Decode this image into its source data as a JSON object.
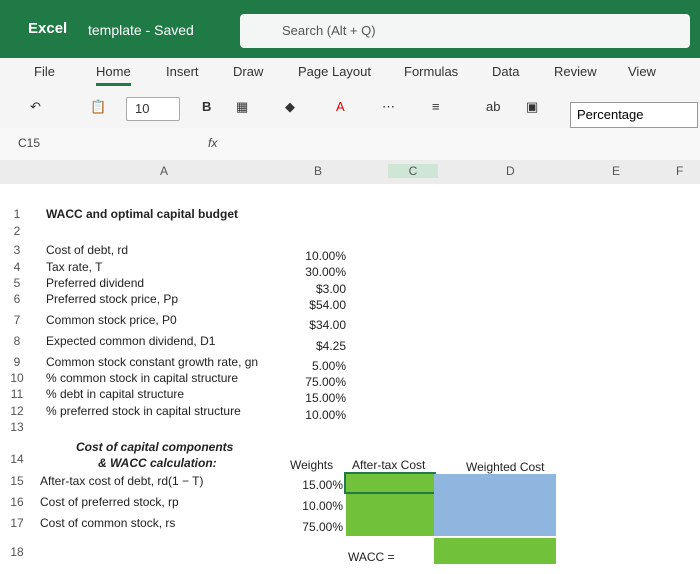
{
  "titlebar": {
    "app_name": "Excel",
    "doc_title": "template - Saved",
    "search_placeholder": "Search (Alt + Q)"
  },
  "ribbon": {
    "tabs": [
      "File",
      "Home",
      "Insert",
      "Draw",
      "Page Layout",
      "Formulas",
      "Data",
      "Review",
      "View"
    ]
  },
  "toolbar": {
    "font_size": "10",
    "bold": "B",
    "number_format": "Percentage"
  },
  "formula_bar": {
    "name_box": "C15",
    "fx": "fx"
  },
  "columns": [
    "A",
    "B",
    "C",
    "D",
    "E",
    "F"
  ],
  "rows": [
    "1",
    "2",
    "3",
    "4",
    "5",
    "6",
    "7",
    "8",
    "9",
    "10",
    "11",
    "12",
    "13",
    "14",
    "15",
    "16",
    "17",
    "18"
  ],
  "sheet": {
    "title": "WACC and optimal capital budget",
    "labels": [
      "Cost of debt, rd",
      "Tax rate, T",
      "Preferred dividend",
      "Preferred stock price, Pp",
      "Common stock price, P0",
      "Expected common dividend, D1",
      "Common stock constant growth rate, gn",
      "% common stock in capital structure",
      "% debt in capital structure",
      "% preferred stock in capital structure"
    ],
    "values": [
      "10.00%",
      "30.00%",
      "$3.00",
      "$54.00",
      "$34.00",
      "$4.25",
      "5.00%",
      "75.00%",
      "15.00%",
      "10.00%"
    ],
    "section_title_line1": "Cost of capital components",
    "section_title_line2": "& WACC calculation:",
    "col_weights": "Weights",
    "col_after_tax": "After-tax Cost",
    "col_weighted": "Weighted Cost",
    "row15": "After-tax cost of debt, rd(1 − T)",
    "row16": "Cost of preferred stock, rp",
    "row17": "Cost of common stock, rs",
    "w15": "15.00%",
    "w16": "10.00%",
    "w17": "75.00%",
    "wacc": "WACC ="
  }
}
